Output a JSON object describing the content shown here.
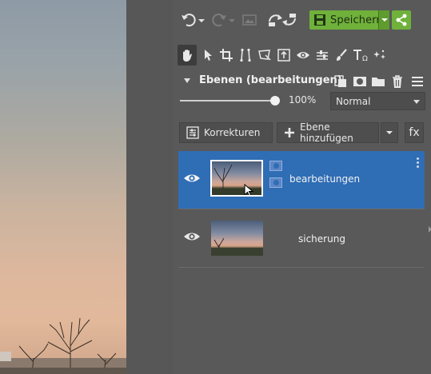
{
  "toolbar": {
    "undo_icon": "undo-icon",
    "redo_icon": "redo-icon",
    "save_label": "Speichern",
    "share_icon": "share-icon"
  },
  "tools": [
    "hand-icon",
    "pointer-icon",
    "crop-icon",
    "straighten-icon",
    "transform-icon",
    "export-icon",
    "eye-icon",
    "levels-icon",
    "brush-icon",
    "text-icon",
    "effects-icon"
  ],
  "layers_panel": {
    "title": "Ebenen (bearbeitungen)",
    "opacity": "100%",
    "opacity_value": 1.0,
    "blend_mode": "Normal",
    "corrections_label": "Korrekturen",
    "add_layer_label": "Ebene hinzufügen",
    "fx_label": "fx"
  },
  "layers": [
    {
      "name": "bearbeitungen",
      "selected": true
    },
    {
      "name": "sicherung",
      "selected": false
    }
  ],
  "colors": {
    "save_green": "#6fb13a",
    "selection_blue": "#2f6db5",
    "panel_bg": "#595959"
  }
}
